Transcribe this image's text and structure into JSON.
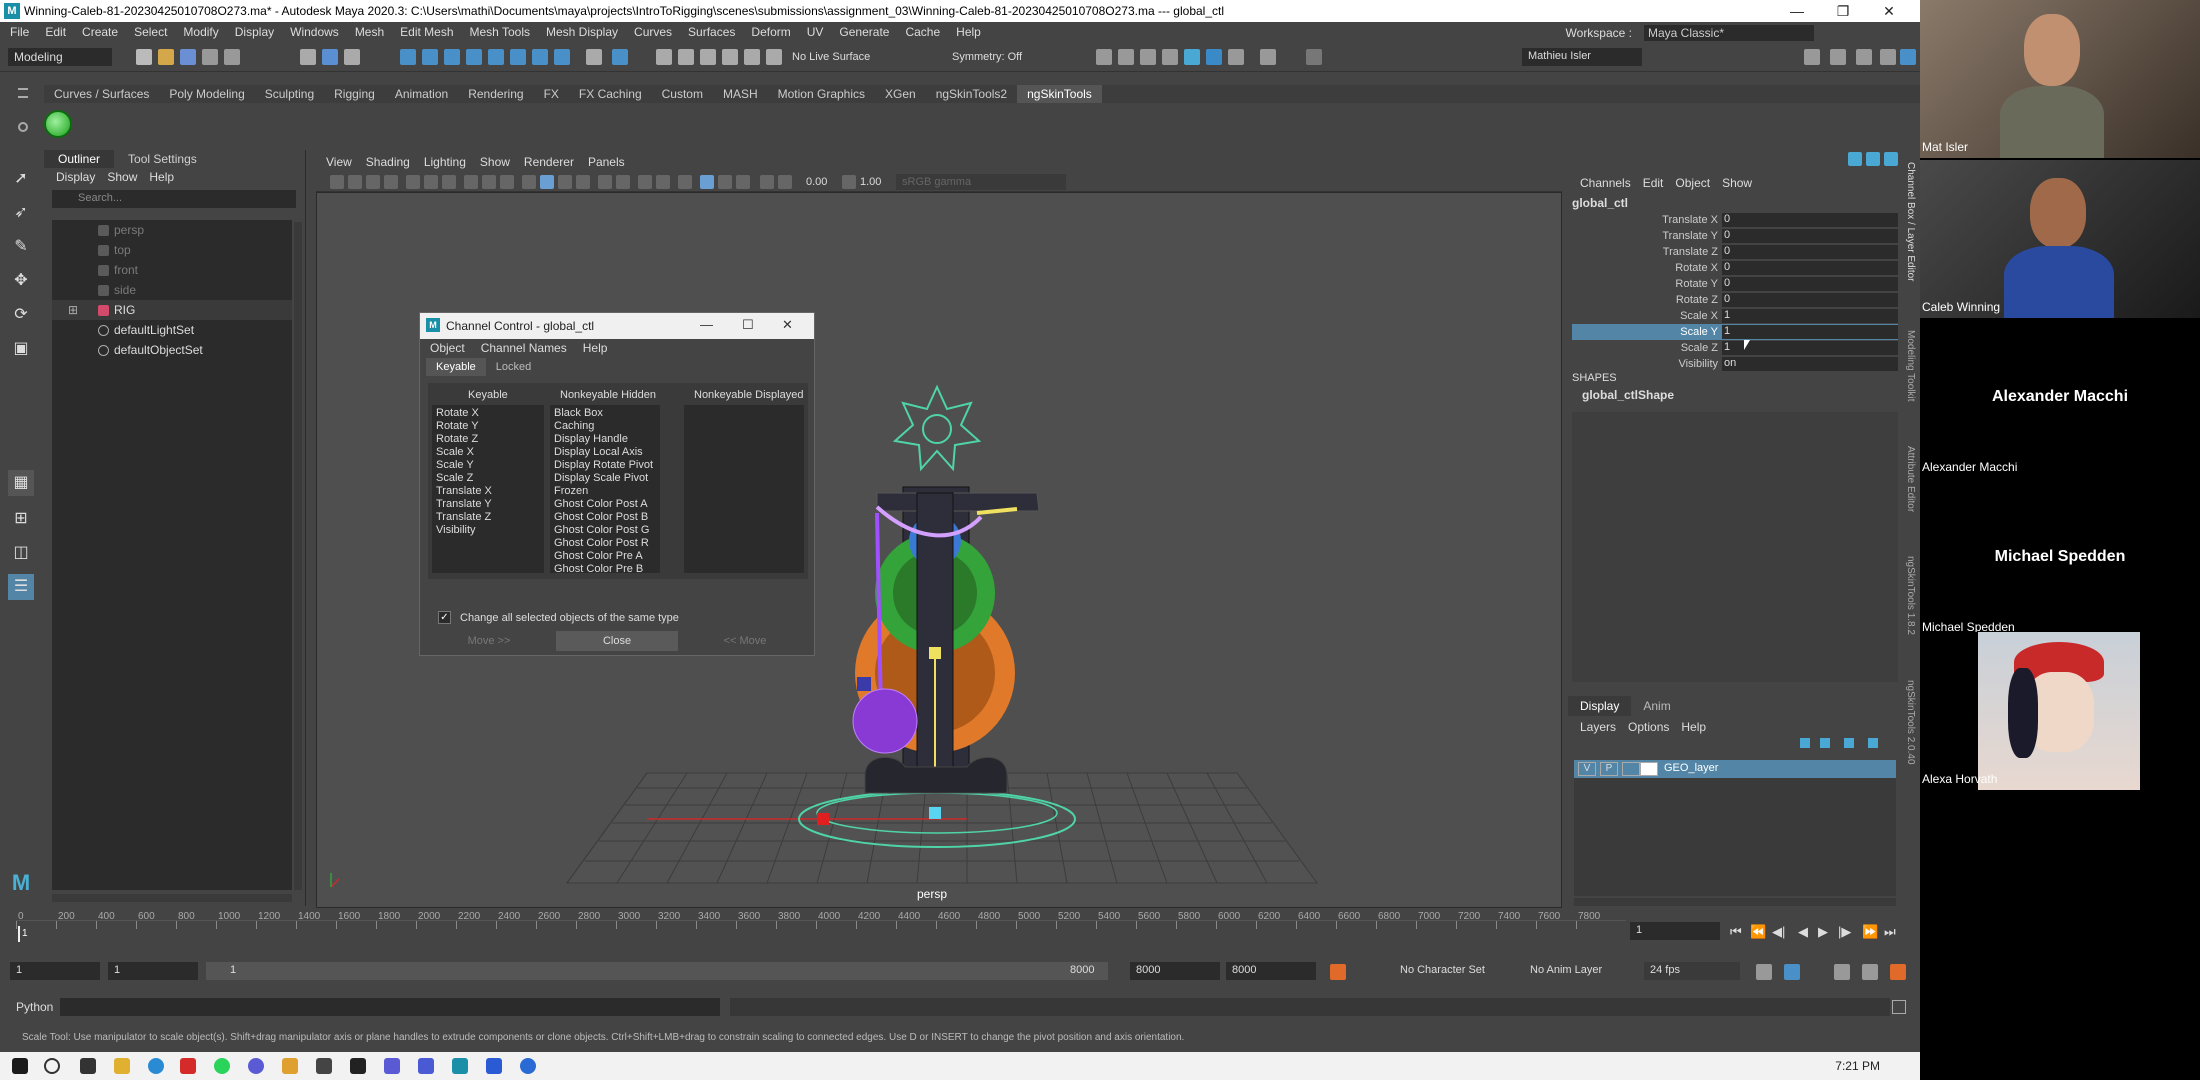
{
  "window": {
    "title": "Winning-Caleb-81-20230425010708O273.ma* - Autodesk Maya 2020.3: C:\\Users\\mathi\\Documents\\maya\\projects\\IntroToRigging\\scenes\\submissions\\assignment_03\\Winning-Caleb-81-20230425010708O273.ma  ---  global_ctl",
    "minimize": "—",
    "restore": "❐",
    "close": "✕"
  },
  "menubar": [
    "File",
    "Edit",
    "Create",
    "Select",
    "Modify",
    "Display",
    "Windows",
    "Mesh",
    "Edit Mesh",
    "Mesh Tools",
    "Mesh Display",
    "Curves",
    "Surfaces",
    "Deform",
    "UV",
    "Generate",
    "Cache",
    "Help"
  ],
  "workspace": {
    "label": "Workspace :",
    "value": "Maya Classic*"
  },
  "statusline": {
    "mode": "Modeling",
    "live_surface": "No Live Surface",
    "symmetry": "Symmetry: Off",
    "user": "Mathieu Isler"
  },
  "shelf_tabs": [
    "Curves / Surfaces",
    "Poly Modeling",
    "Sculpting",
    "Rigging",
    "Animation",
    "Rendering",
    "FX",
    "FX Caching",
    "Custom",
    "MASH",
    "Motion Graphics",
    "XGen",
    "ngSkinTools2",
    "ngSkinTools"
  ],
  "shelf_active": "ngSkinTools",
  "outliner": {
    "tabs": [
      "Outliner",
      "Tool Settings"
    ],
    "menu": [
      "Display",
      "Show",
      "Help"
    ],
    "search_placeholder": "Search...",
    "items": [
      {
        "label": "persp",
        "dim": true
      },
      {
        "label": "top",
        "dim": true
      },
      {
        "label": "front",
        "dim": true
      },
      {
        "label": "side",
        "dim": true
      },
      {
        "label": "RIG",
        "dim": false
      },
      {
        "label": "defaultLightSet",
        "dim": false
      },
      {
        "label": "defaultObjectSet",
        "dim": false
      }
    ]
  },
  "viewport": {
    "menu": [
      "View",
      "Shading",
      "Lighting",
      "Show",
      "Renderer",
      "Panels"
    ],
    "field1": "0.00",
    "field2": "1.00",
    "colorspace": "sRGB gamma",
    "camera": "persp"
  },
  "channel_control": {
    "title": "Channel Control - global_ctl",
    "menu": [
      "Object",
      "Channel Names",
      "Help"
    ],
    "tabs": [
      "Keyable",
      "Locked"
    ],
    "col_keyable": "Keyable",
    "col_hidden": "Nonkeyable Hidden",
    "col_displayed": "Nonkeyable Displayed",
    "keyable": [
      "Rotate X",
      "Rotate Y",
      "Rotate Z",
      "Scale X",
      "Scale Y",
      "Scale Z",
      "Translate X",
      "Translate Y",
      "Translate Z",
      "Visibility"
    ],
    "hidden": [
      "Black Box",
      "Caching",
      "Display Handle",
      "Display Local Axis",
      "Display Rotate Pivot",
      "Display Scale Pivot",
      "Frozen",
      "Ghost Color Post A",
      "Ghost Color Post B",
      "Ghost Color Post G",
      "Ghost Color Post R",
      "Ghost Color Pre A",
      "Ghost Color Pre B"
    ],
    "checkbox_label": "Change all selected objects of the same type",
    "checkbox_mark": "✓",
    "move_right": "Move >>",
    "close": "Close",
    "move_left": "<< Move"
  },
  "channel_box": {
    "menu": [
      "Channels",
      "Edit",
      "Object",
      "Show"
    ],
    "object": "global_ctl",
    "attrs": [
      {
        "label": "Translate X",
        "value": "0"
      },
      {
        "label": "Translate Y",
        "value": "0"
      },
      {
        "label": "Translate Z",
        "value": "0"
      },
      {
        "label": "Rotate X",
        "value": "0"
      },
      {
        "label": "Rotate Y",
        "value": "0"
      },
      {
        "label": "Rotate Z",
        "value": "0"
      },
      {
        "label": "Scale X",
        "value": "1"
      },
      {
        "label": "Scale Y",
        "value": "1"
      },
      {
        "label": "Scale Z",
        "value": "1"
      },
      {
        "label": "Visibility",
        "value": "on"
      }
    ],
    "selected_attr": "Scale Y",
    "shapes_header": "SHAPES",
    "shape": "global_ctlShape"
  },
  "side_tabs": [
    "Channel Box / Layer Editor",
    "Modeling Toolkit",
    "Attribute Editor",
    "ngSkinTools 1.8.2",
    "ngSkinTools 2.0.40"
  ],
  "layer_editor": {
    "tabs": [
      "Display",
      "Anim"
    ],
    "menu": [
      "Layers",
      "Options",
      "Help"
    ],
    "layer": {
      "v": "V",
      "p": "P",
      "name": "GEO_layer"
    }
  },
  "timeslider": {
    "ticks": [
      "0",
      "200",
      "400",
      "600",
      "800",
      "1000",
      "1200",
      "1400",
      "1600",
      "1800",
      "2000",
      "2200",
      "2400",
      "2600",
      "2800",
      "3000",
      "3200",
      "3400",
      "3600",
      "3800",
      "4000",
      "4200",
      "4400",
      "4600",
      "4800",
      "5000",
      "5200",
      "5400",
      "5600",
      "5800",
      "6000",
      "6200",
      "6400",
      "6600",
      "6800",
      "7000",
      "7200",
      "7400",
      "7600",
      "7800"
    ],
    "current": "1",
    "current_marker": "1"
  },
  "range": {
    "start": "1",
    "start2": "1",
    "bar_start": "1",
    "bar_end": "8000",
    "end": "8000",
    "end2": "8000",
    "char_set": "No Character Set",
    "anim_layer": "No Anim Layer",
    "fps": "24 fps"
  },
  "cmdline": {
    "label": "Python"
  },
  "helpline": "Scale Tool: Use manipulator to scale object(s). Shift+drag manipulator axis or plane handles to extrude components or clone objects. Ctrl+Shift+LMB+drag to constrain scaling to connected edges. Use D or INSERT to change the pivot position and axis orientation.",
  "taskbar": {
    "clock": "7:21 PM"
  },
  "call": {
    "participants": [
      {
        "name": "Mat Isler",
        "video": true
      },
      {
        "name": "Caleb Winning",
        "video": true
      },
      {
        "name": "Alexander Macchi",
        "video": false,
        "center": "Alexander Macchi"
      },
      {
        "name": "Michael Spedden",
        "video": false,
        "center": "Michael Spedden"
      },
      {
        "name": "Alexa Horvath",
        "video": true
      }
    ]
  },
  "colors": {
    "selection": "#5285a6",
    "gear_green": "#33a33a",
    "gear_orange": "#e07a2a",
    "gear_blue": "#3a7ad4",
    "ball_purple": "#8a3ad4",
    "ctl_cyan": "#4fd4a8"
  }
}
